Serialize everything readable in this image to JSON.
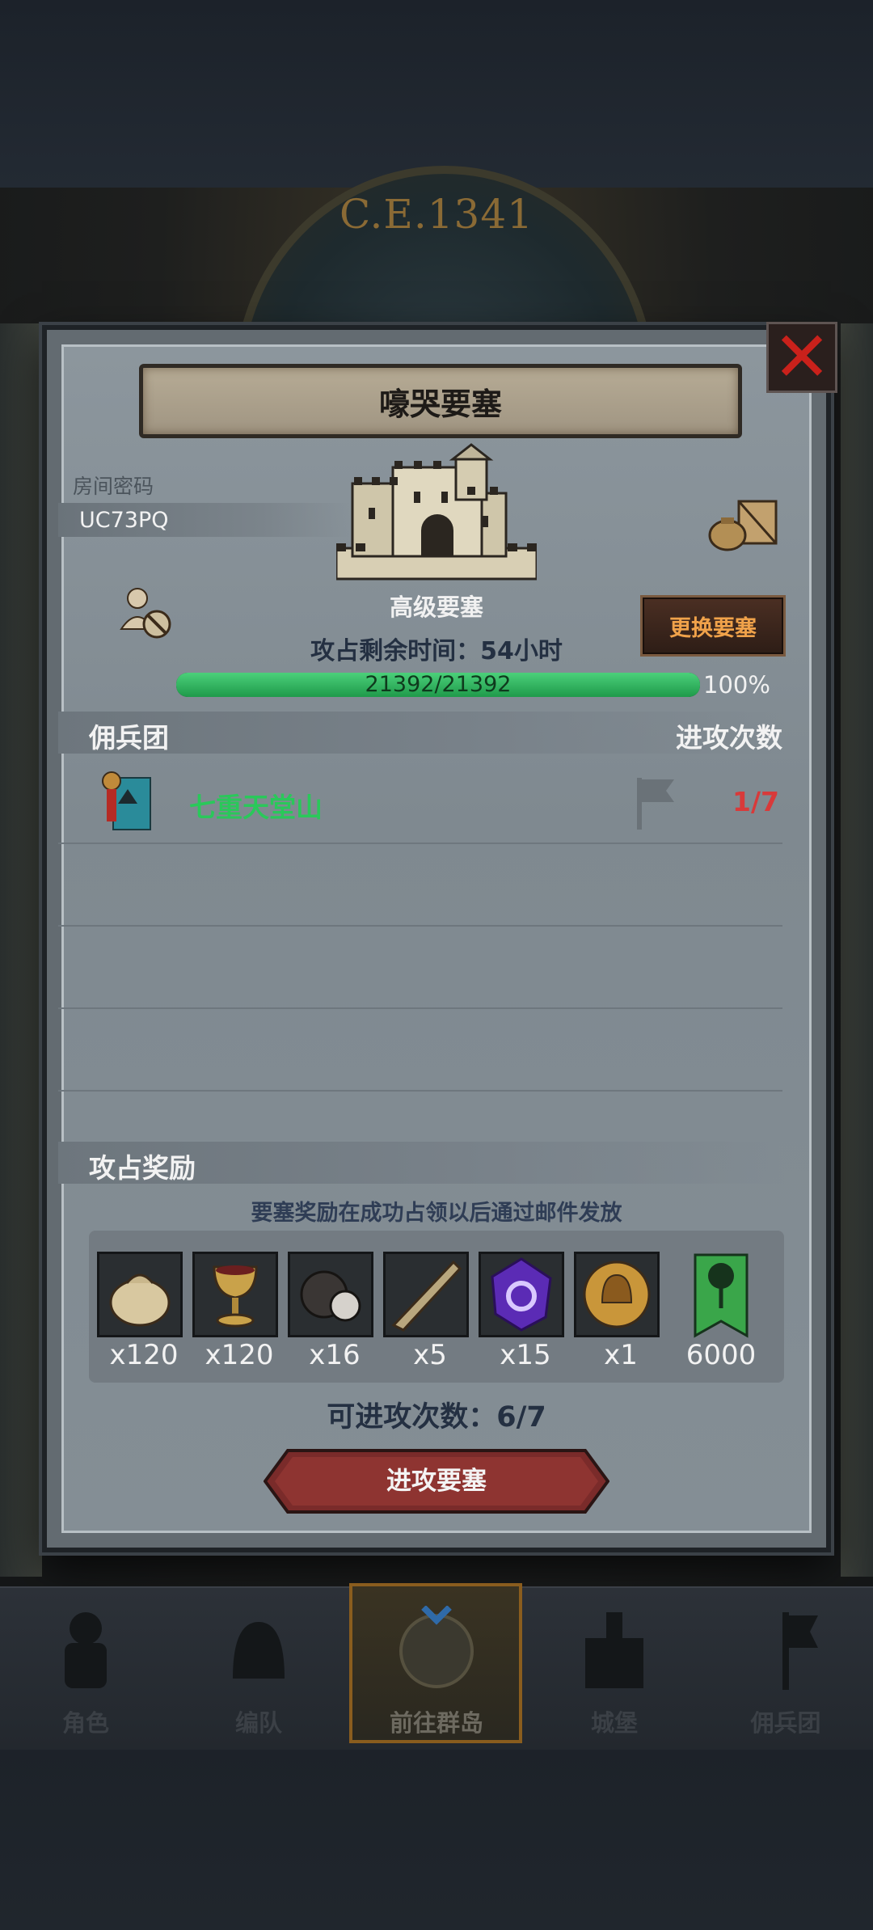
{
  "era": "C.E.1341",
  "dialog": {
    "title": "嚎哭要塞",
    "room_label": "房间密码",
    "room_code": "UC73PQ",
    "fortress_type": "高级要塞",
    "change_button": "更换要塞",
    "time_left": "攻占剩余时间：54小时",
    "hp": {
      "current": 21392,
      "max": 21392,
      "text": "21392/21392",
      "percent_text": "100%",
      "fill": 1.0
    },
    "mercenary_header": "佣兵团",
    "attacks_header": "进攻次数",
    "guilds": [
      {
        "name": "七重天堂山",
        "attacks": "1/7"
      }
    ],
    "rewards_header": "攻占奖励",
    "rewards_note": "要塞奖励在成功占领以后通过邮件发放",
    "rewards": [
      {
        "icon": "cloth-sack-icon",
        "qty": "x120"
      },
      {
        "icon": "golden-goblet-icon",
        "qty": "x120"
      },
      {
        "icon": "truffle-icon",
        "qty": "x16"
      },
      {
        "icon": "horn-icon",
        "qty": "x5"
      },
      {
        "icon": "purple-crystal-icon",
        "qty": "x15"
      },
      {
        "icon": "knight-helmet-coin-icon",
        "qty": "x1"
      },
      {
        "icon": "tree-banner-icon",
        "qty": "6000"
      }
    ],
    "remaining_attacks": "可进攻次数：6/7",
    "attack_button": "进攻要塞"
  },
  "nav": [
    {
      "label": "角色",
      "icon": "knight-icon"
    },
    {
      "label": "编队",
      "icon": "helmet-icon"
    },
    {
      "label": "前往群岛",
      "icon": "compass-map-icon",
      "active": true
    },
    {
      "label": "城堡",
      "icon": "castle-icon"
    },
    {
      "label": "佣兵团",
      "icon": "mercenary-flag-icon"
    }
  ],
  "colors": {
    "accent_green": "#2ac85a",
    "warning_red": "#d83a3a",
    "close_red": "#c9211b",
    "button_orange": "#f0a24a"
  }
}
